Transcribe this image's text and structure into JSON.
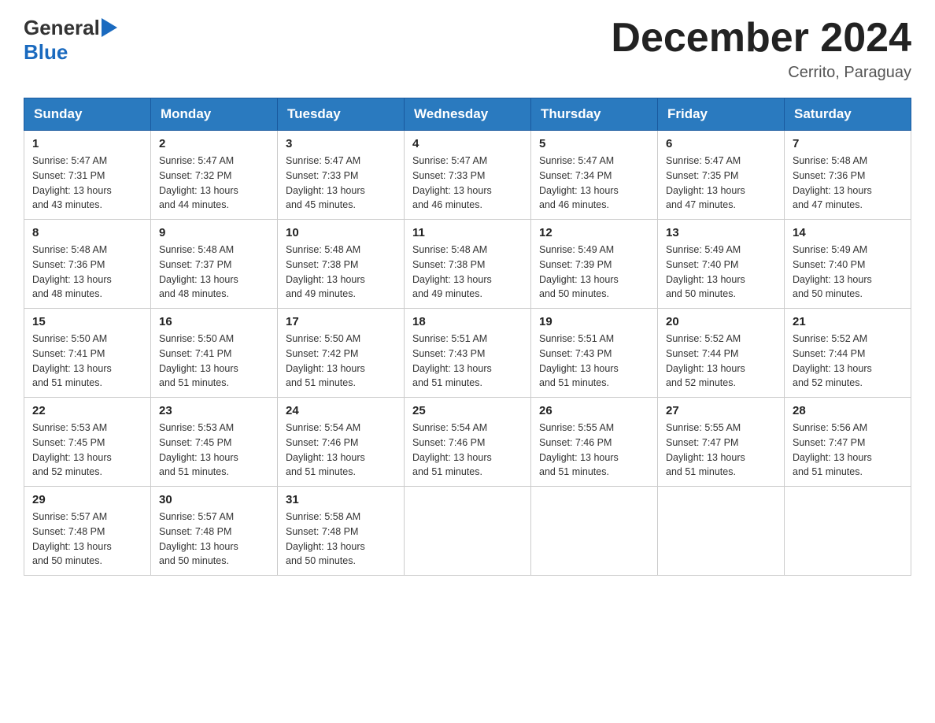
{
  "header": {
    "logo_general": "General",
    "logo_blue": "Blue",
    "title": "December 2024",
    "subtitle": "Cerrito, Paraguay"
  },
  "days_of_week": [
    "Sunday",
    "Monday",
    "Tuesday",
    "Wednesday",
    "Thursday",
    "Friday",
    "Saturday"
  ],
  "weeks": [
    [
      {
        "day": "1",
        "sunrise": "5:47 AM",
        "sunset": "7:31 PM",
        "daylight": "13 hours and 43 minutes."
      },
      {
        "day": "2",
        "sunrise": "5:47 AM",
        "sunset": "7:32 PM",
        "daylight": "13 hours and 44 minutes."
      },
      {
        "day": "3",
        "sunrise": "5:47 AM",
        "sunset": "7:33 PM",
        "daylight": "13 hours and 45 minutes."
      },
      {
        "day": "4",
        "sunrise": "5:47 AM",
        "sunset": "7:33 PM",
        "daylight": "13 hours and 46 minutes."
      },
      {
        "day": "5",
        "sunrise": "5:47 AM",
        "sunset": "7:34 PM",
        "daylight": "13 hours and 46 minutes."
      },
      {
        "day": "6",
        "sunrise": "5:47 AM",
        "sunset": "7:35 PM",
        "daylight": "13 hours and 47 minutes."
      },
      {
        "day": "7",
        "sunrise": "5:48 AM",
        "sunset": "7:36 PM",
        "daylight": "13 hours and 47 minutes."
      }
    ],
    [
      {
        "day": "8",
        "sunrise": "5:48 AM",
        "sunset": "7:36 PM",
        "daylight": "13 hours and 48 minutes."
      },
      {
        "day": "9",
        "sunrise": "5:48 AM",
        "sunset": "7:37 PM",
        "daylight": "13 hours and 48 minutes."
      },
      {
        "day": "10",
        "sunrise": "5:48 AM",
        "sunset": "7:38 PM",
        "daylight": "13 hours and 49 minutes."
      },
      {
        "day": "11",
        "sunrise": "5:48 AM",
        "sunset": "7:38 PM",
        "daylight": "13 hours and 49 minutes."
      },
      {
        "day": "12",
        "sunrise": "5:49 AM",
        "sunset": "7:39 PM",
        "daylight": "13 hours and 50 minutes."
      },
      {
        "day": "13",
        "sunrise": "5:49 AM",
        "sunset": "7:40 PM",
        "daylight": "13 hours and 50 minutes."
      },
      {
        "day": "14",
        "sunrise": "5:49 AM",
        "sunset": "7:40 PM",
        "daylight": "13 hours and 50 minutes."
      }
    ],
    [
      {
        "day": "15",
        "sunrise": "5:50 AM",
        "sunset": "7:41 PM",
        "daylight": "13 hours and 51 minutes."
      },
      {
        "day": "16",
        "sunrise": "5:50 AM",
        "sunset": "7:41 PM",
        "daylight": "13 hours and 51 minutes."
      },
      {
        "day": "17",
        "sunrise": "5:50 AM",
        "sunset": "7:42 PM",
        "daylight": "13 hours and 51 minutes."
      },
      {
        "day": "18",
        "sunrise": "5:51 AM",
        "sunset": "7:43 PM",
        "daylight": "13 hours and 51 minutes."
      },
      {
        "day": "19",
        "sunrise": "5:51 AM",
        "sunset": "7:43 PM",
        "daylight": "13 hours and 51 minutes."
      },
      {
        "day": "20",
        "sunrise": "5:52 AM",
        "sunset": "7:44 PM",
        "daylight": "13 hours and 52 minutes."
      },
      {
        "day": "21",
        "sunrise": "5:52 AM",
        "sunset": "7:44 PM",
        "daylight": "13 hours and 52 minutes."
      }
    ],
    [
      {
        "day": "22",
        "sunrise": "5:53 AM",
        "sunset": "7:45 PM",
        "daylight": "13 hours and 52 minutes."
      },
      {
        "day": "23",
        "sunrise": "5:53 AM",
        "sunset": "7:45 PM",
        "daylight": "13 hours and 51 minutes."
      },
      {
        "day": "24",
        "sunrise": "5:54 AM",
        "sunset": "7:46 PM",
        "daylight": "13 hours and 51 minutes."
      },
      {
        "day": "25",
        "sunrise": "5:54 AM",
        "sunset": "7:46 PM",
        "daylight": "13 hours and 51 minutes."
      },
      {
        "day": "26",
        "sunrise": "5:55 AM",
        "sunset": "7:46 PM",
        "daylight": "13 hours and 51 minutes."
      },
      {
        "day": "27",
        "sunrise": "5:55 AM",
        "sunset": "7:47 PM",
        "daylight": "13 hours and 51 minutes."
      },
      {
        "day": "28",
        "sunrise": "5:56 AM",
        "sunset": "7:47 PM",
        "daylight": "13 hours and 51 minutes."
      }
    ],
    [
      {
        "day": "29",
        "sunrise": "5:57 AM",
        "sunset": "7:48 PM",
        "daylight": "13 hours and 50 minutes."
      },
      {
        "day": "30",
        "sunrise": "5:57 AM",
        "sunset": "7:48 PM",
        "daylight": "13 hours and 50 minutes."
      },
      {
        "day": "31",
        "sunrise": "5:58 AM",
        "sunset": "7:48 PM",
        "daylight": "13 hours and 50 minutes."
      },
      null,
      null,
      null,
      null
    ]
  ],
  "labels": {
    "sunrise": "Sunrise:",
    "sunset": "Sunset:",
    "daylight": "Daylight:"
  }
}
